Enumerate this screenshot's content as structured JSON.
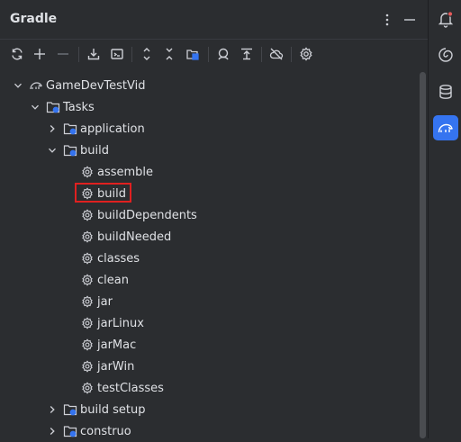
{
  "panel": {
    "title": "Gradle",
    "header_icons": [
      "more-vertical-icon",
      "minimize-icon"
    ]
  },
  "toolbar": {
    "buttons": [
      "reload-icon",
      "add-icon",
      "remove-icon",
      "download-sources-icon",
      "execute-task-icon",
      "expand-all-icon",
      "collapse-all-icon",
      "link-project-icon",
      "analyze-dependencies-icon",
      "toggle-offline-icon-top",
      "offline-mode-icon",
      "settings-icon"
    ]
  },
  "tree": {
    "project": "GameDevTestVid",
    "tasks_label": "Tasks",
    "groups": [
      {
        "label": "application",
        "expanded": false
      },
      {
        "label": "build",
        "expanded": true,
        "tasks": [
          "assemble",
          "build",
          "buildDependents",
          "buildNeeded",
          "classes",
          "clean",
          "jar",
          "jarLinux",
          "jarMac",
          "jarWin",
          "testClasses"
        ]
      },
      {
        "label": "build setup",
        "expanded": false
      },
      {
        "label": "construo",
        "expanded": false
      }
    ],
    "selected_task": "build"
  },
  "sidebar": {
    "items": [
      "notifications-icon",
      "ai-assistant-icon",
      "database-icon",
      "gradle-icon"
    ],
    "active": "gradle-icon"
  },
  "colors": {
    "background": "#2b2d30",
    "text": "#dfe1e5",
    "accent": "#3574f0",
    "highlight_border": "#e02020",
    "notification_dot": "#e55a5a"
  }
}
